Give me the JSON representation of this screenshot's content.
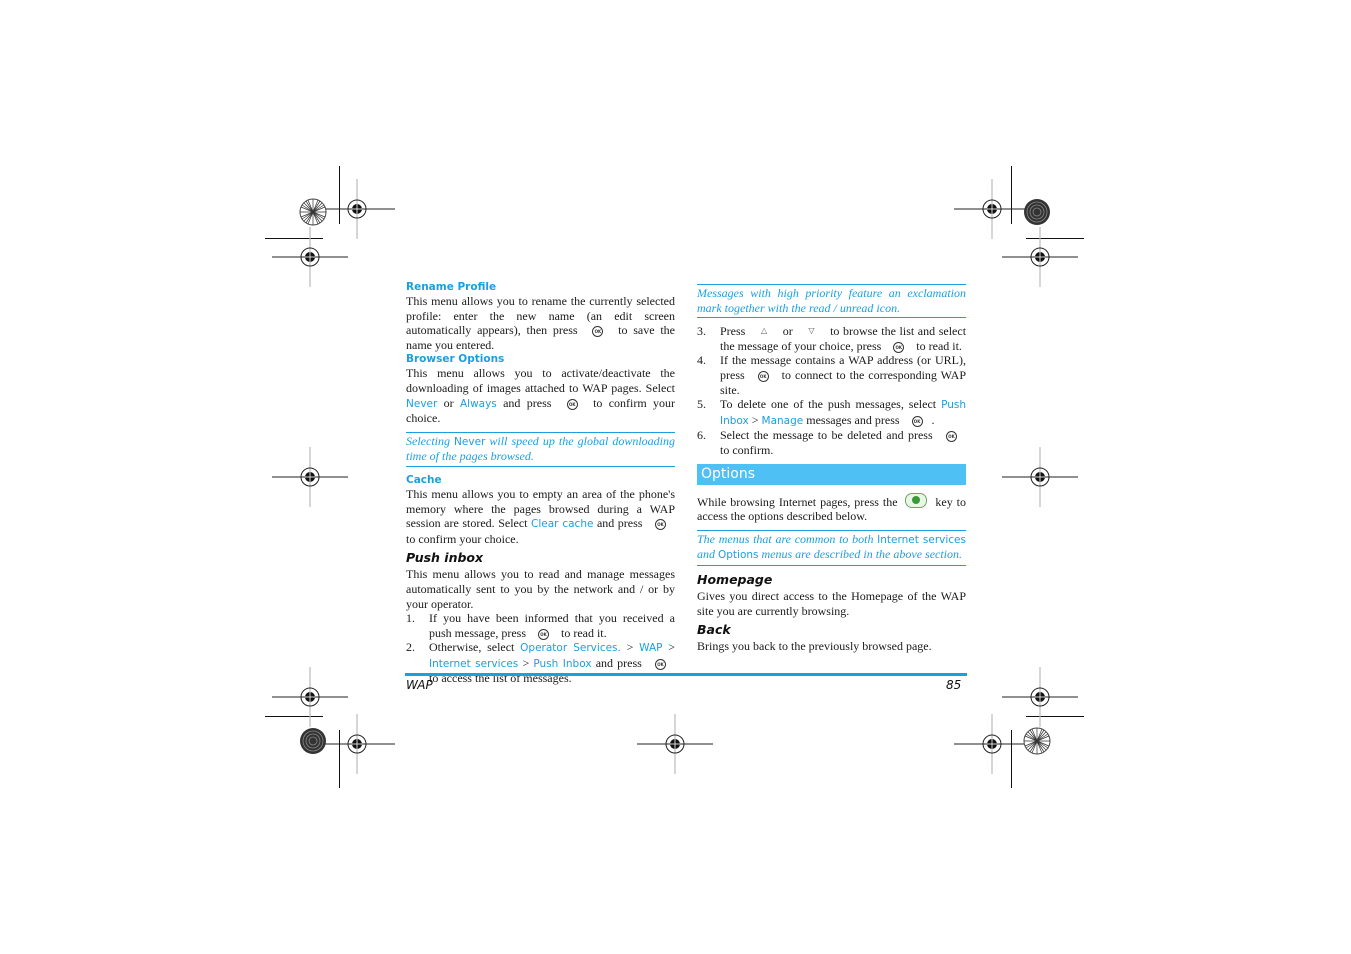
{
  "left_column": {
    "rename_profile": {
      "heading": "Rename Profile",
      "text_1": "This menu allows you to rename the currently selected profile: enter the new name (an edit screen automatically appears), then press",
      "key": "OK",
      "text_2": "to save the name you entered."
    },
    "browser_options": {
      "heading": "Browser Options",
      "text_1": "This menu allows you to activate/deactivate the downloading of images attached to WAP pages. Select",
      "link_never": "Never",
      "text_or": "or",
      "link_always": "Always",
      "text_2": "and press",
      "key": "OK",
      "text_3": "to confirm your choice."
    },
    "note_never": {
      "text_1": "Selecting",
      "menu": "Never",
      "text_2": "will speed up the global downloading time of the pages browsed."
    },
    "cache": {
      "heading": "Cache",
      "text_1": "This menu allows you to empty an area of the phone's memory where the pages browsed during a WAP session are stored. Select",
      "link_clear_cache": "Clear cache",
      "text_2": "and press",
      "key": "OK",
      "text_3": "to confirm your choice."
    },
    "push_inbox": {
      "heading": "Push inbox",
      "intro": "This menu allows you to read and manage messages automatically sent to you by the network and / or by your operator.",
      "steps": [
        {
          "num": "1.",
          "text_1": "If you have been informed that you received a push message, press",
          "key": "OK",
          "text_2": "to read it."
        },
        {
          "num": "2.",
          "text_1": "Otherwise, select",
          "path": [
            "Operator Services.",
            "WAP",
            "Internet services",
            "Push Inbox"
          ],
          "sep": ">",
          "text_2": "and press",
          "key": "OK",
          "text_3": "to access the list of messages."
        }
      ]
    }
  },
  "right_column": {
    "note_priority": "Messages with high priority feature an exclamation mark together with the read / unread icon.",
    "steps": [
      {
        "num": "3.",
        "text_1": "Press",
        "up_key": "△",
        "or": "or",
        "down_key": "▽",
        "text_2": "to browse the list and select the message of your choice, press",
        "key": "OK",
        "text_3": "to read it."
      },
      {
        "num": "4.",
        "text_1": "If the message contains a WAP address (or URL), press",
        "key": "OK",
        "text_2": "to connect to the corresponding WAP site."
      },
      {
        "num": "5.",
        "text_1": "To delete one of the push messages, select",
        "link_push_inbox": "Push Inbox",
        "sep": ">",
        "link_manage": "Manage",
        "text_2": "messages and press",
        "key": "OK",
        "text_3": "."
      },
      {
        "num": "6.",
        "text_1": "Select the message to be deleted and press",
        "key": "OK",
        "text_2": "to confirm."
      }
    ],
    "options_banner": "Options",
    "options_intro_1": "While browsing Internet pages, press the",
    "options_intro_2": "key to access the options described below.",
    "note_common": {
      "text_1": "The menus that are common to both",
      "menu_internet": "Internet services",
      "text_and": "and",
      "menu_options": "Options",
      "text_2": "menus are described in the above section."
    },
    "homepage": {
      "heading": "Homepage",
      "text": "Gives you direct access to the Homepage of the WAP site you are currently browsing."
    },
    "back": {
      "heading": "Back",
      "text": "Brings you back to the previously browsed page."
    }
  },
  "footer": {
    "section": "WAP",
    "page_number": "85"
  },
  "colors": {
    "accent": "#1a9fe0",
    "banner": "#4fc0f3"
  }
}
